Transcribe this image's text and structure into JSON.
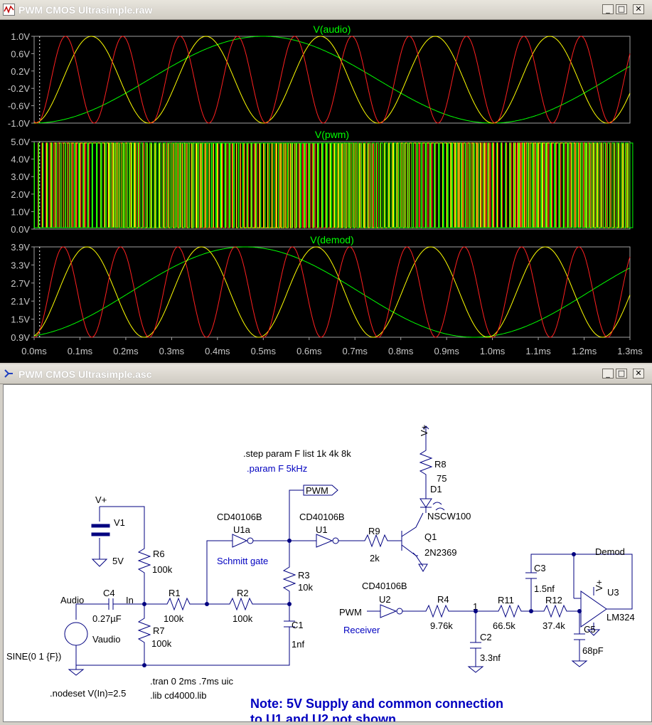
{
  "waveform_window": {
    "title": "PWM CMOS Ultrasimple.raw",
    "buttons": {
      "minimize": "_",
      "maximize": "□",
      "close": "✕"
    },
    "panes": [
      {
        "trace": "V(audio)",
        "y_ticks": [
          "1.0V",
          "0.6V",
          "0.2V",
          "-0.2V",
          "-0.6V",
          "-1.0V"
        ]
      },
      {
        "trace": "V(pwm)",
        "y_ticks": [
          "5.0V",
          "4.0V",
          "3.0V",
          "2.0V",
          "1.0V",
          "0.0V"
        ]
      },
      {
        "trace": "V(demod)",
        "y_ticks": [
          "3.9V",
          "3.3V",
          "2.7V",
          "2.1V",
          "1.5V",
          "0.9V"
        ]
      }
    ],
    "x_ticks": [
      "0.0ms",
      "0.1ms",
      "0.2ms",
      "0.3ms",
      "0.4ms",
      "0.5ms",
      "0.6ms",
      "0.7ms",
      "0.8ms",
      "0.9ms",
      "1.0ms",
      "1.1ms",
      "1.2ms",
      "1.3ms"
    ],
    "colors": {
      "step_1k": "#00ff00",
      "step_4k": "#ffff00",
      "step_8k": "#ff2020",
      "grid": "#a0a0a0",
      "label": "#00ff00"
    }
  },
  "schematic_window": {
    "title": "PWM CMOS Ultrasimple.asc",
    "buttons": {
      "minimize": "_",
      "maximize": "□",
      "close": "✕"
    },
    "labels": {
      "step_directive": ".step param F list 1k 4k 8k",
      "param_directive": ".param F 5kHz",
      "tran_directive": ".tran 0 2ms .7ms uic",
      "lib_directive": ".lib cd4000.lib",
      "nodeset_directive": ".nodeset V(In)=2.5",
      "vplus_v1": "V+",
      "v1_name": "V1",
      "v1_value": "5V",
      "r6_name": "R6",
      "r6_value": "100k",
      "r7_name": "R7",
      "r7_value": "100k",
      "audio_net": "Audio",
      "in_net": "In",
      "c4_name": "C4",
      "c4_value": "0.27µF",
      "vaudio_name": "Vaudio",
      "sine_value": "SINE(0 1 {F})",
      "r1_name": "R1",
      "r1_value": "100k",
      "r2_name": "R2",
      "r2_value": "100k",
      "u1a_part": "CD40106B",
      "u1a_name": "U1a",
      "schmitt_label": "Schmitt gate",
      "u1_part": "CD40106B",
      "u1_name": "U1",
      "pwm_flag": "PWM",
      "r3_name": "R3",
      "r3_value": "10k",
      "c1_name": "C1",
      "c1_value": "1nf",
      "r9_name": "R9",
      "r9_value": "2k",
      "vplus_q": "V+",
      "r8_name": "R8",
      "r8_value": "75",
      "d1_name": "D1",
      "d1_value": "NSCW100",
      "q1_name": "Q1",
      "q1_value": "2N2369",
      "u2_part": "CD40106B",
      "u2_name": "U2",
      "pwm_in": "PWM",
      "receiver_label": "Receiver",
      "r4_name": "R4",
      "r4_value": "9.76k",
      "node1": "1",
      "c2_name": "C2",
      "c2_value": "3.3nf",
      "r11_name": "R11",
      "r11_value": "66.5k",
      "r12_name": "R12",
      "r12_value": "37.4k",
      "c3_name": "C3",
      "c3_value": "1.5nf",
      "c5_name": "C5",
      "c5_value": "68pF",
      "demod_net": "Demod",
      "u3_name": "U3",
      "u3_value": "LM324",
      "vplus_u3": "V+",
      "note_line1": "Note:  5V Supply and common connection",
      "note_line2": "to U1 and U2  not shown."
    }
  }
}
